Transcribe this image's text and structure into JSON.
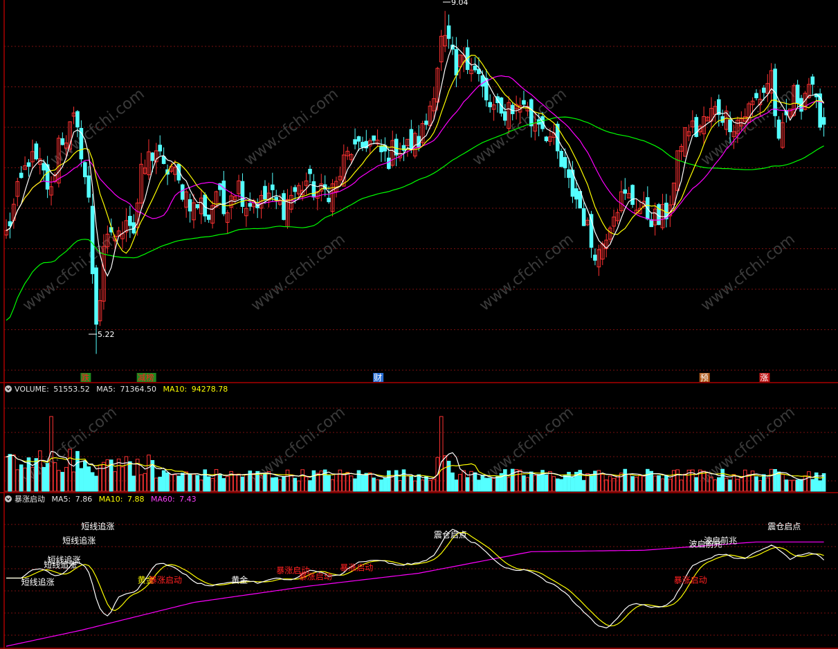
{
  "colors": {
    "up": "#ff3232",
    "down": "#54ffff",
    "grid": "#7a1010",
    "border": "#aa0000",
    "ma5": "#ffffff",
    "ma10": "#ffff00",
    "ma20": "#ff00ff",
    "ma60": "#00ff00",
    "signal_white": "#ffffff",
    "signal_red": "#ff2020"
  },
  "price_panel": {
    "high_label": "9.04",
    "low_label": "5.22",
    "markers": [
      {
        "text": "跌",
        "color": "#ff2020",
        "bg": "#1f8a1f",
        "i": 20
      },
      {
        "text": "减榜",
        "color": "#ff2020",
        "bg": "#1f8a1f",
        "i": 35
      },
      {
        "text": "财",
        "color": "#ffffff",
        "bg": "#2a6fd6",
        "i": 98
      },
      {
        "text": "预",
        "color": "#ffffff",
        "bg": "#b05a1a",
        "i": 185
      },
      {
        "text": "涨",
        "color": "#ffffff",
        "bg": "#c01818",
        "i": 201
      }
    ]
  },
  "volume_panel": {
    "name": "VOLUME:",
    "value": "51553.52",
    "ma5_label": "MA5:",
    "ma5_value": "71364.50",
    "ma10_label": "MA10:",
    "ma10_value": "94278.78"
  },
  "indicator_panel": {
    "name": "暴涨启动",
    "ma5_label": "MA5:",
    "ma5_value": "7.86",
    "ma10_label": "MA10:",
    "ma10_value": "7.88",
    "ma60_label": "MA60:",
    "ma60_value": "7.43",
    "signals": [
      {
        "text": "短线追涨",
        "color": "#ffffff",
        "i": 4,
        "y": 7.8
      },
      {
        "text": "短线追涨",
        "color": "#ffffff",
        "i": 10,
        "y": 8.05
      },
      {
        "text": "短线追涨",
        "color": "#ffffff",
        "i": 11,
        "y": 8.12
      },
      {
        "text": "短线追涨",
        "color": "#ffffff",
        "i": 15,
        "y": 8.4
      },
      {
        "text": "短线追涨",
        "color": "#ffffff",
        "i": 20,
        "y": 8.6
      },
      {
        "text": "黄金",
        "color": "#ffff00",
        "i": 35,
        "y": 7.83
      },
      {
        "text": "暴涨启动",
        "color": "#ff2020",
        "i": 38,
        "y": 7.83
      },
      {
        "text": "黄金",
        "color": "#ffffff",
        "i": 60,
        "y": 7.83
      },
      {
        "text": "暴涨启动",
        "color": "#ff2020",
        "i": 72,
        "y": 7.97
      },
      {
        "text": "暴涨启动",
        "color": "#ff2020",
        "i": 78,
        "y": 7.88
      },
      {
        "text": "暴涨启动",
        "color": "#ff2020",
        "i": 89,
        "y": 8.01
      },
      {
        "text": "震仓启点",
        "color": "#ffffff",
        "i": 114,
        "y": 8.48
      },
      {
        "text": "暴涨启动",
        "color": "#ff2020",
        "i": 178,
        "y": 7.83
      },
      {
        "text": "波启前兆",
        "color": "#ffffff",
        "i": 182,
        "y": 8.35
      },
      {
        "text": "波启前兆",
        "color": "#ffffff",
        "i": 186,
        "y": 8.4
      },
      {
        "text": "震仓启点",
        "color": "#ffffff",
        "i": 203,
        "y": 8.6
      }
    ]
  },
  "watermark": "www.cfchi.com",
  "chart_data": {
    "type": "candlestick",
    "description_series": [
      "MA5",
      "MA10",
      "MA20",
      "MA60",
      "VOLUME",
      "VOL MA5",
      "VOL MA10",
      "暴涨启动 MA5",
      "暴涨启动 MA10",
      "暴涨启动 MA60"
    ],
    "y_range": [
      5.0,
      9.1
    ],
    "highest": 9.04,
    "lowest": 5.22,
    "candles_count": 219,
    "close_path": [
      [
        0,
        6.55
      ],
      [
        3,
        7.0
      ],
      [
        6,
        7.4
      ],
      [
        9,
        7.3
      ],
      [
        12,
        7.0
      ],
      [
        14,
        7.6
      ],
      [
        16,
        7.65
      ],
      [
        18,
        7.8
      ],
      [
        20,
        7.5
      ],
      [
        22,
        6.9
      ],
      [
        24,
        5.4
      ],
      [
        26,
        6.3
      ],
      [
        28,
        6.6
      ],
      [
        30,
        6.5
      ],
      [
        32,
        6.8
      ],
      [
        34,
        6.6
      ],
      [
        36,
        7.2
      ],
      [
        38,
        7.4
      ],
      [
        40,
        7.5
      ],
      [
        42,
        7.25
      ],
      [
        44,
        7.3
      ],
      [
        46,
        7.1
      ],
      [
        48,
        7.0
      ],
      [
        50,
        6.85
      ],
      [
        52,
        6.9
      ],
      [
        54,
        6.75
      ],
      [
        56,
        7.05
      ],
      [
        58,
        6.8
      ],
      [
        60,
        7.05
      ],
      [
        62,
        7.1
      ],
      [
        64,
        6.9
      ],
      [
        66,
        6.95
      ],
      [
        68,
        6.9
      ],
      [
        70,
        7.0
      ],
      [
        72,
        6.9
      ],
      [
        74,
        6.85
      ],
      [
        76,
        7.0
      ],
      [
        78,
        7.05
      ],
      [
        80,
        7.15
      ],
      [
        82,
        7.05
      ],
      [
        84,
        7.0
      ],
      [
        86,
        7.05
      ],
      [
        88,
        7.1
      ],
      [
        90,
        7.35
      ],
      [
        92,
        7.5
      ],
      [
        94,
        7.45
      ],
      [
        96,
        7.6
      ],
      [
        98,
        7.55
      ],
      [
        100,
        7.45
      ],
      [
        102,
        7.4
      ],
      [
        104,
        7.55
      ],
      [
        106,
        7.5
      ],
      [
        108,
        7.55
      ],
      [
        110,
        7.6
      ],
      [
        112,
        7.8
      ],
      [
        114,
        8.2
      ],
      [
        116,
        8.7
      ],
      [
        118,
        8.65
      ],
      [
        120,
        8.3
      ],
      [
        122,
        8.6
      ],
      [
        124,
        8.45
      ],
      [
        126,
        8.3
      ],
      [
        128,
        8.0
      ],
      [
        130,
        7.95
      ],
      [
        132,
        7.85
      ],
      [
        134,
        8.0
      ],
      [
        136,
        7.95
      ],
      [
        138,
        8.05
      ],
      [
        140,
        7.8
      ],
      [
        142,
        7.85
      ],
      [
        144,
        7.7
      ],
      [
        146,
        7.55
      ],
      [
        148,
        7.3
      ],
      [
        150,
        7.1
      ],
      [
        152,
        6.95
      ],
      [
        154,
        6.75
      ],
      [
        156,
        6.45
      ],
      [
        158,
        6.35
      ],
      [
        160,
        6.6
      ],
      [
        162,
        6.85
      ],
      [
        164,
        6.95
      ],
      [
        166,
        6.95
      ],
      [
        168,
        6.9
      ],
      [
        170,
        6.8
      ],
      [
        172,
        6.75
      ],
      [
        174,
        6.7
      ],
      [
        176,
        6.8
      ],
      [
        178,
        7.1
      ],
      [
        180,
        7.6
      ],
      [
        182,
        7.75
      ],
      [
        184,
        7.7
      ],
      [
        186,
        7.8
      ],
      [
        188,
        7.9
      ],
      [
        190,
        7.95
      ],
      [
        192,
        7.85
      ],
      [
        194,
        7.8
      ],
      [
        196,
        7.85
      ],
      [
        198,
        7.95
      ],
      [
        200,
        8.05
      ],
      [
        202,
        8.15
      ],
      [
        204,
        8.35
      ],
      [
        206,
        7.5
      ],
      [
        208,
        7.85
      ],
      [
        210,
        8.1
      ],
      [
        212,
        8.05
      ],
      [
        214,
        8.25
      ],
      [
        216,
        7.95
      ],
      [
        218,
        7.8
      ]
    ],
    "volume_range": [
      0,
      200000
    ],
    "indicator_range": [
      6.9,
      8.95
    ],
    "indicator_ma60_path": [
      [
        0,
        6.92
      ],
      [
        20,
        7.15
      ],
      [
        50,
        7.55
      ],
      [
        80,
        7.78
      ],
      [
        110,
        7.97
      ],
      [
        140,
        8.28
      ],
      [
        170,
        8.3
      ],
      [
        200,
        8.42
      ],
      [
        218,
        8.42
      ]
    ]
  }
}
